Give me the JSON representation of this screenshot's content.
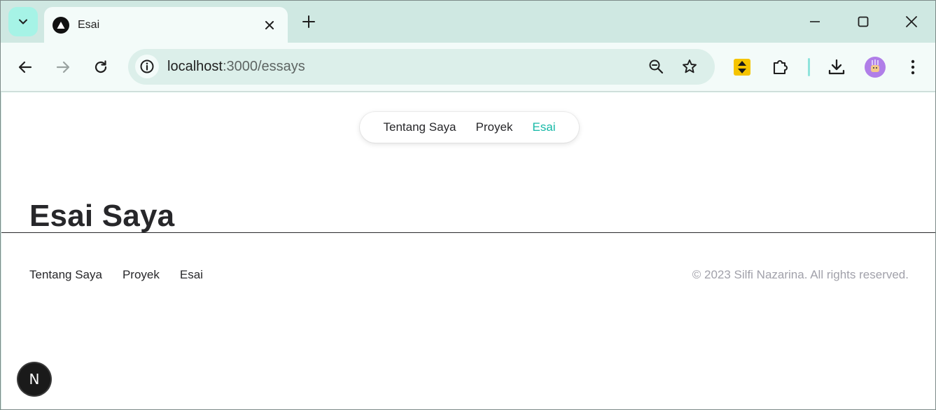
{
  "browser": {
    "tab": {
      "title": "Esai"
    },
    "address": {
      "host": "localhost",
      "path": ":3000/essays"
    }
  },
  "icons": {
    "tab_search": "chevron-down-icon",
    "favicon": "triangle-icon",
    "tab_close": "close-icon",
    "new_tab": "plus-icon",
    "minimize": "minimize-icon",
    "maximize": "maximize-icon",
    "close_window": "close-icon",
    "back": "arrow-left-icon",
    "forward": "arrow-right-icon",
    "reload": "reload-icon",
    "site_info": "info-icon",
    "zoom": "zoom-out-icon",
    "bookmark": "star-icon",
    "extension": "extension-badge-icon",
    "extensions": "puzzle-icon",
    "download": "download-icon",
    "profile": "avatar-icon",
    "menu": "more-vertical-icon"
  },
  "colors": {
    "accent": "#14b8a6",
    "tab_search_bg": "#a6f3e6",
    "frame": "#cfe8e2"
  },
  "nav": {
    "items": [
      {
        "label": "Tentang Saya"
      },
      {
        "label": "Proyek"
      },
      {
        "label": "Esai"
      }
    ]
  },
  "main": {
    "title": "Esai Saya"
  },
  "footer": {
    "links": [
      {
        "label": "Tentang Saya"
      },
      {
        "label": "Proyek"
      },
      {
        "label": "Esai"
      }
    ],
    "copyright": "© 2023 Silfi Nazarina. All rights reserved."
  },
  "dev_badge": {
    "label": "N"
  }
}
